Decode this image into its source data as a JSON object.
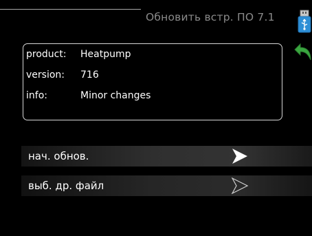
{
  "header": {
    "title": "Обновить встр. ПО 7.1",
    "icons": [
      "usb-stick-icon",
      "back-arrow-icon"
    ]
  },
  "info": {
    "rows": [
      {
        "key": "product:",
        "value": "Heatpump"
      },
      {
        "key": "version:",
        "value": "716"
      },
      {
        "key": "info:",
        "value": "Minor changes"
      }
    ]
  },
  "menu": {
    "items": [
      {
        "label": "нач. обнов.",
        "icon": "arrow-filled-icon"
      },
      {
        "label": "выб. др. файл",
        "icon": "arrow-outline-icon"
      }
    ]
  },
  "colors": {
    "background": "#000000",
    "title": "#8a8a8a",
    "accent_blue": "#2e8fd6",
    "accent_green": "#3aa640"
  }
}
